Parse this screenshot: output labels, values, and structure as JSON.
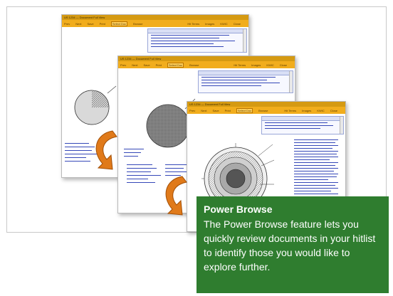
{
  "caption": {
    "title": "Power Browse",
    "body": "The Power Browse feature lets you quickly review documents in your hitlist to identify those you would like to explore further."
  },
  "windows": {
    "back": {
      "title": "US 1234 — Document Full View",
      "toolbar": [
        "Prev",
        "Next",
        "Save",
        "Print",
        "Select Doc",
        "Browse",
        "Hit Terms",
        "Images",
        "KWIC",
        "Close"
      ]
    },
    "middle": {
      "title": "US 1234 — Document Full View",
      "toolbar": [
        "Prev",
        "Next",
        "Save",
        "Print",
        "Select Doc",
        "Browse",
        "Hit Terms",
        "Images",
        "KWIC",
        "Close"
      ]
    },
    "front": {
      "title": "US 1234 — Document Full View",
      "toolbar": [
        "Prev",
        "Next",
        "Save",
        "Print",
        "Select Doc",
        "Browse",
        "Hit Terms",
        "Images",
        "KWIC",
        "Close"
      ]
    }
  },
  "colors": {
    "toolbar": "#f1ad1d",
    "titlebar": "#d59a12",
    "caption_bg": "#2f7d2f",
    "arrow": "#e07a1a"
  },
  "icons": {
    "arrow": "curved-arrow-icon"
  }
}
